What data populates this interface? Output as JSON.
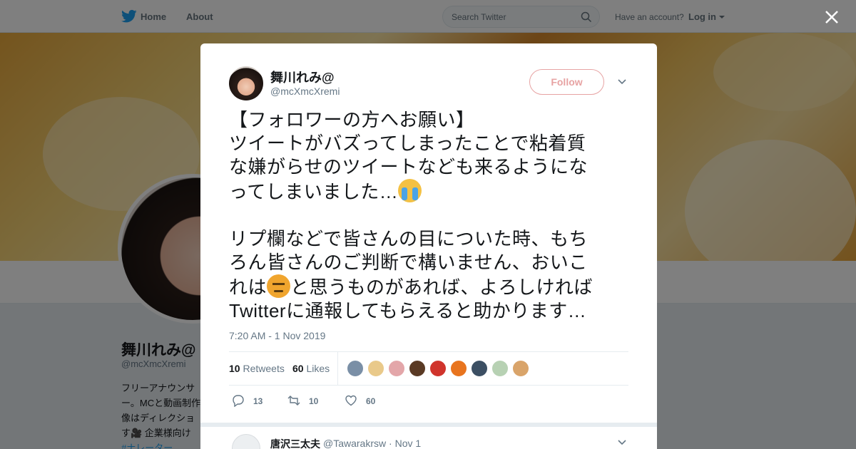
{
  "nav": {
    "home_label": "Home",
    "about_label": "About",
    "search_placeholder": "Search Twitter",
    "have_account": "Have an account?",
    "login_label": "Log in"
  },
  "profile": {
    "name": "舞川れみ@",
    "handle": "@mcXmcXremi",
    "bio_lines": [
      "フリーアナウンサ",
      "ー。MCと動画制作",
      "像はディレクショ",
      "す🎥 企業様向け"
    ],
    "bio_tag": "#ナレーター"
  },
  "tweet": {
    "author_name": "舞川れみ@",
    "author_handle": "@mcXmcXremi",
    "follow_label": "Follow",
    "text_part1": "【フォロワーの方へお願い】\nツイートがバズってしまったことで粘着質\nな嫌がらせのツイートなども来るようにな\nってしまいました…",
    "text_part2": "\n\nリプ欄などで皆さんの目についた時、もち\nろん皆さんのご判断で構いません、おいこ\nれは",
    "text_part3": "と思うものがあれば、よろしければ\nTwitterに通報してもらえると助かります…",
    "emoji_1": "loudly-crying-face",
    "emoji_2": "angry-face",
    "timestamp": "7:20 AM - 1 Nov 2019",
    "retweets_count": "10",
    "retweets_label": "Retweets",
    "likes_count": "60",
    "likes_label": "Likes",
    "liker_colors": [
      "#7a8fa6",
      "#e9c98a",
      "#e3a6a9",
      "#5a3a24",
      "#d0342c",
      "#e8741e",
      "#3c4f63",
      "#b7d1b3",
      "#d9a46a"
    ],
    "reply_count": "13",
    "retweet_count_action": "10",
    "like_count_action": "60"
  },
  "reply": {
    "name": "唐沢三太夫",
    "handle": "@Tawarakrsw",
    "date": "Nov 1"
  },
  "colors": {
    "accent": "#1da1f2",
    "follow_border": "#e7a3a3",
    "muted": "#657786"
  }
}
